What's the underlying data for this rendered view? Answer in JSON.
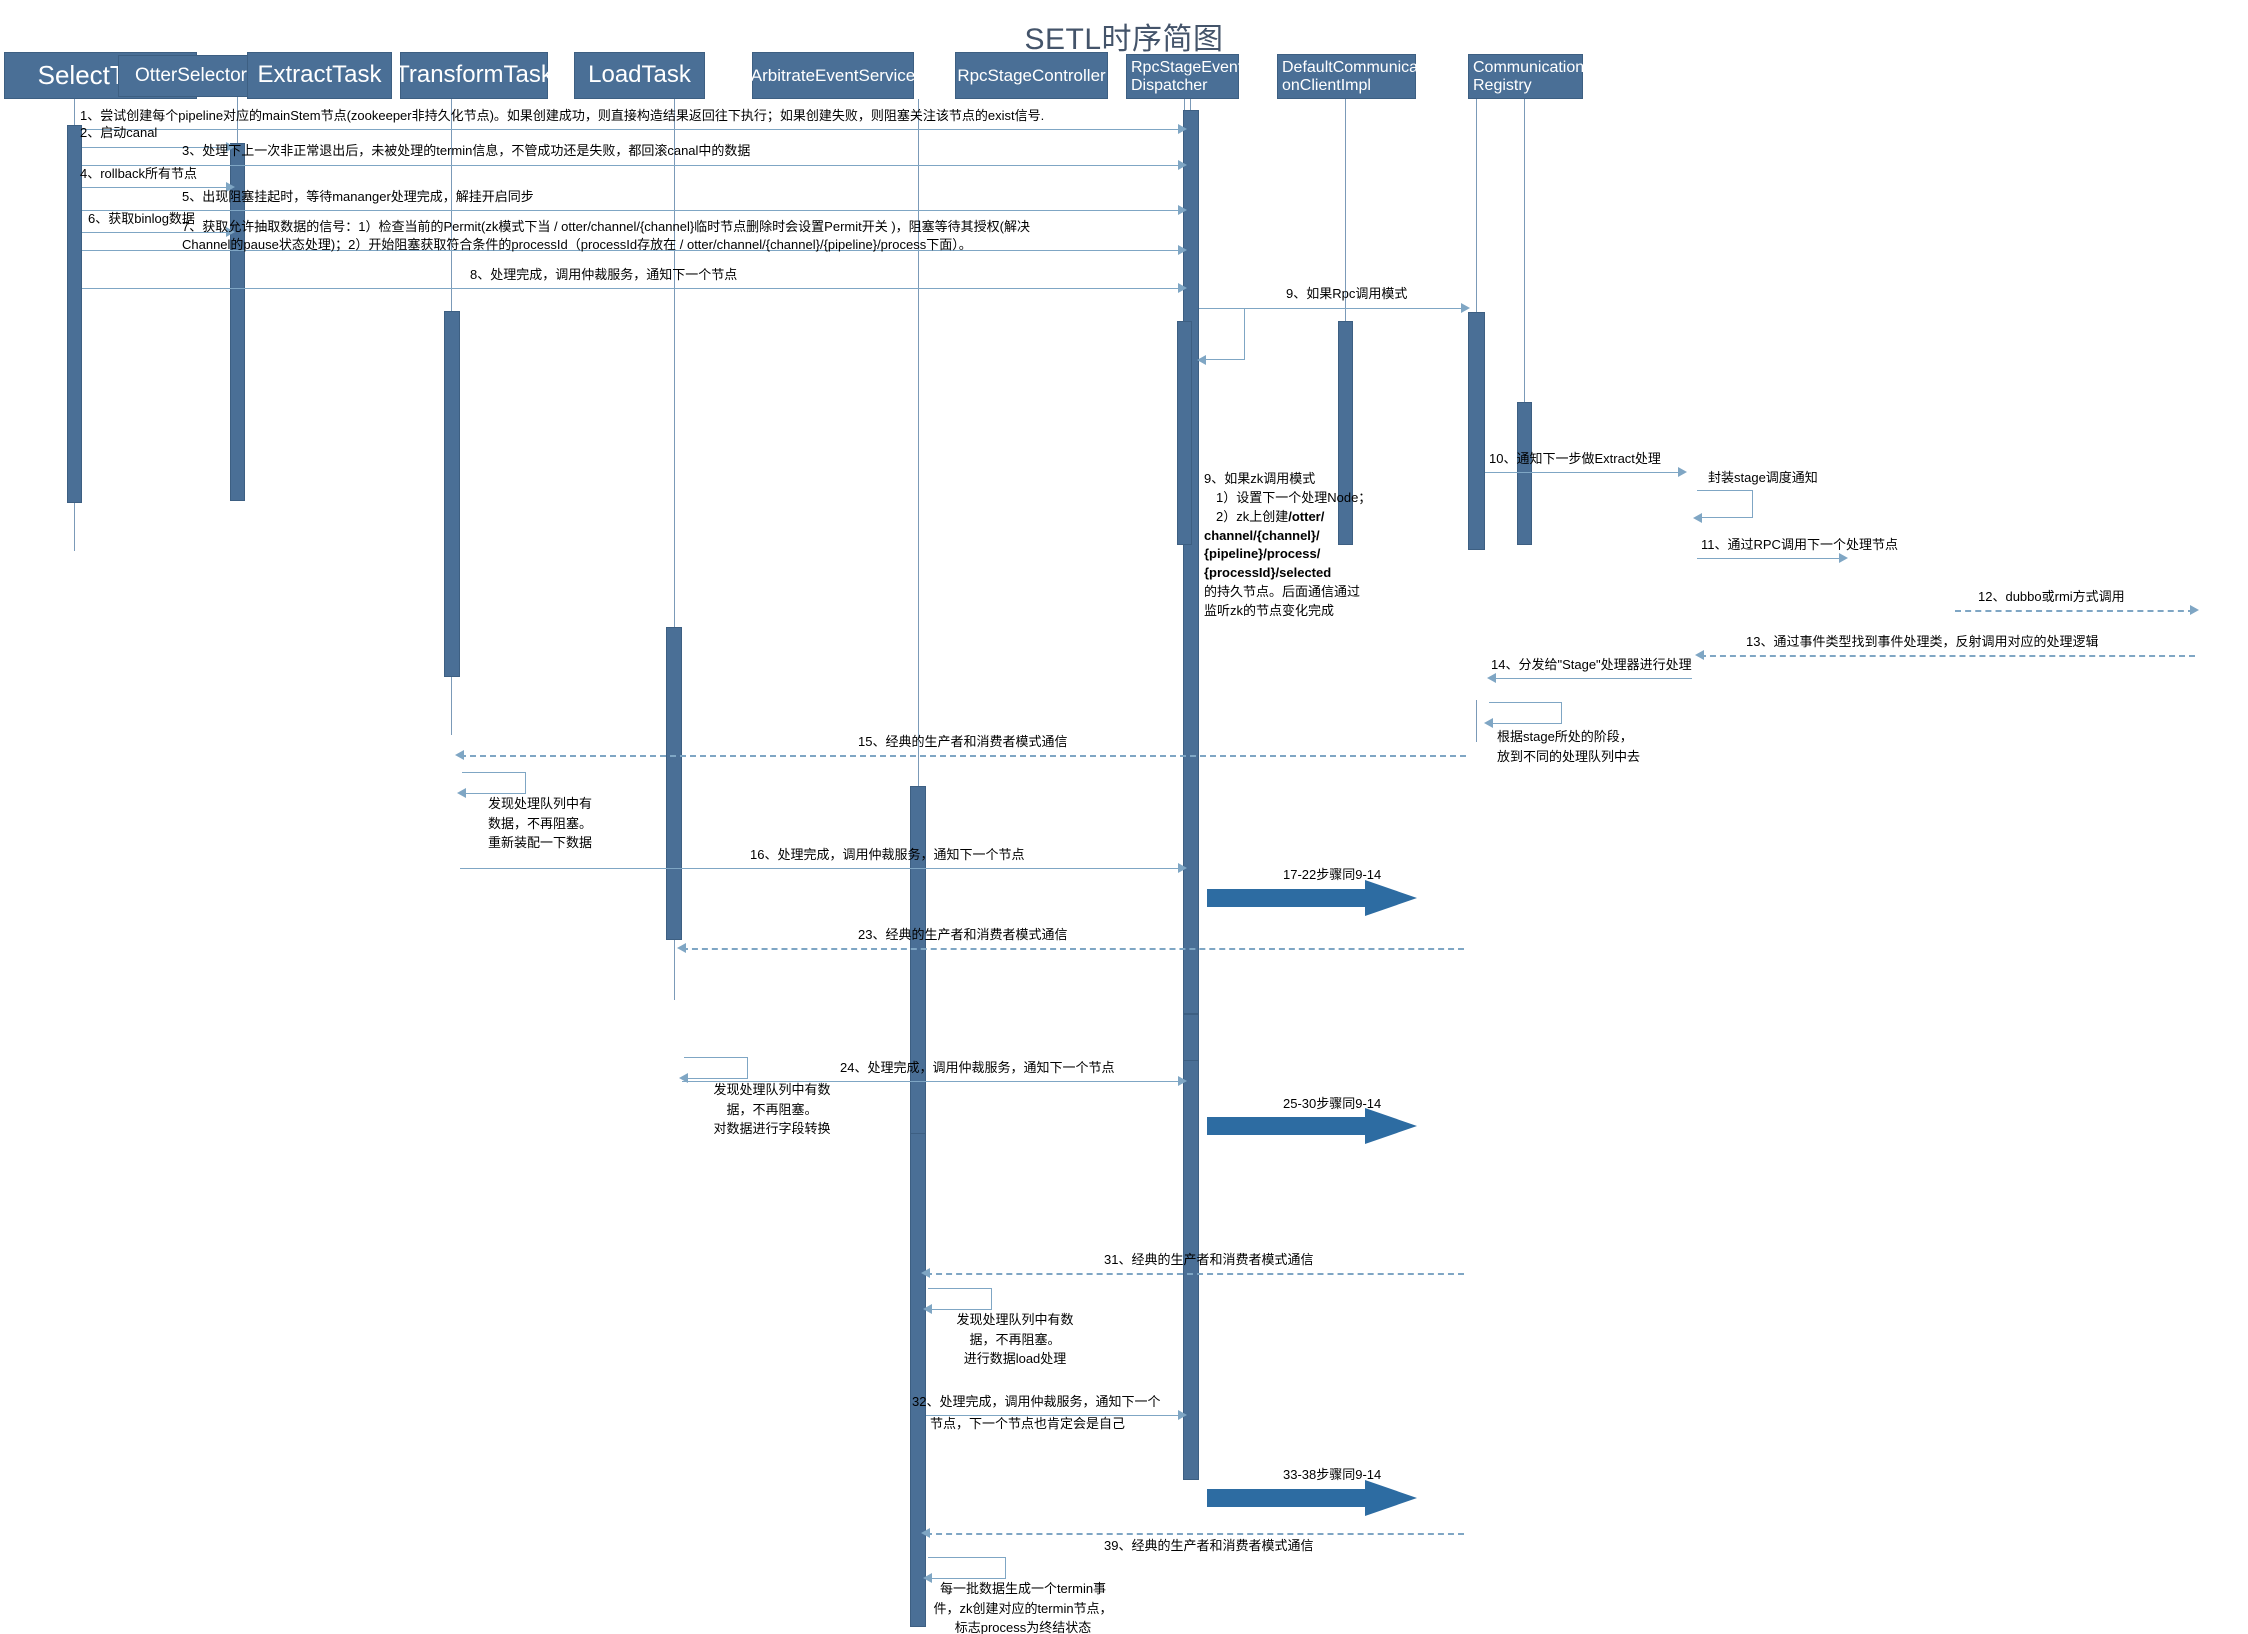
{
  "title": "SETL时序简图",
  "colors": {
    "lifeline_fill": "#4a6f96",
    "message_line": "#7fa6c4",
    "big_arrow": "#2d6ca2",
    "title_text": "#44546a"
  },
  "participants": [
    {
      "name": "SelectTask",
      "label": "SelectTask"
    },
    {
      "name": "OtterSelector",
      "label": "OtterSelector"
    },
    {
      "name": "ExtractTask",
      "label": "ExtractTask"
    },
    {
      "name": "TransformTask",
      "label": "TransformTask"
    },
    {
      "name": "LoadTask",
      "label": "LoadTask"
    },
    {
      "name": "ArbitrateEventService",
      "label": "ArbitrateEventService"
    },
    {
      "name": "RpcStageController",
      "label": "RpcStageController"
    },
    {
      "name": "RpcStageEventDispatcher",
      "label": "RpcStageEvent\nDispatcher"
    },
    {
      "name": "DefaultCommunicationClientImpl",
      "label": "DefaultCommunicati\nonClientImpl"
    },
    {
      "name": "CommunicationRegistry",
      "label": "Communication\nRegistry"
    }
  ],
  "messages": [
    {
      "num": "1",
      "text": "1、尝试创建每个pipeline对应的mainStem节点(zookeeper非持久化节点)。如果创建成功，则直接构造结果返回往下执行；如果创建失败，则阻塞关注该节点的exist信号."
    },
    {
      "num": "2",
      "text": "2、启动canal"
    },
    {
      "num": "3",
      "text": "3、处理下上一次非正常退出后，未被处理的termin信息，不管成功还是失败，都回滚canal中的数据"
    },
    {
      "num": "4",
      "text": "4、rollback所有节点"
    },
    {
      "num": "5",
      "text": "5、出现阻塞挂起时，等待mananger处理完成，解挂开启同步"
    },
    {
      "num": "6",
      "text": "6、获取binlog数据"
    },
    {
      "num": "7a",
      "text": "7、获取允许抽取数据的信号：1）检查当前的Permit(zk模式下当 / otter/channel/{channel}临时节点删除时会设置Permit开关 )，阻塞等待其授权(解决"
    },
    {
      "num": "7b",
      "text": "Channel的pause状态处理)；2）开始阻塞获取符合条件的processId（processId存放在 / otter/channel/{channel}/{pipeline}/process下面）。"
    },
    {
      "num": "8",
      "text": "8、处理完成，调用仲裁服务，通知下一个节点"
    },
    {
      "num": "9",
      "text": "9、如果Rpc调用模式"
    },
    {
      "num": "10",
      "text": "10、通知下一步做Extract处理"
    },
    {
      "num": "s1",
      "text": "封装stage调度通知"
    },
    {
      "num": "11",
      "text": "11、通过RPC调用下一个处理节点"
    },
    {
      "num": "12",
      "text": "12、dubbo或rmi方式调用"
    },
    {
      "num": "13",
      "text": "13、通过事件类型找到事件处理类，反射调用对应的处理逻辑"
    },
    {
      "num": "14",
      "text": "14、分发给\"Stage\"处理器进行处理"
    },
    {
      "num": "15",
      "text": "15、经典的生产者和消费者模式通信"
    },
    {
      "num": "16",
      "text": "16、处理完成，调用仲裁服务，通知下一个节点"
    },
    {
      "num": "23",
      "text": "23、经典的生产者和消费者模式通信"
    },
    {
      "num": "24",
      "text": "24、处理完成，调用仲裁服务，通知下一个节点"
    },
    {
      "num": "31",
      "text": "31、经典的生产者和消费者模式通信"
    },
    {
      "num": "32a",
      "text": "32、处理完成，调用仲裁服务，通知下一个"
    },
    {
      "num": "32b",
      "text": "节点，下一个节点也肯定会是自己"
    },
    {
      "num": "39",
      "text": "39、经典的生产者和消费者模式通信"
    }
  ],
  "zk_note": {
    "line1": "9、如果zk调用模式",
    "line2": "1）设置下一个处理Node；",
    "line3": "2）zk上创建",
    "bold1": "/otter/",
    "bold2": "channel/{channel}/",
    "bold3": "{pipeline}/process/",
    "bold4": "{processId}/selected",
    "line4": "的持久节点。后面通信通过",
    "line5": "监听zk的节点变化完成"
  },
  "notes": [
    {
      "name": "stage-queue-note",
      "lines": [
        "根据stage所处的阶段，",
        "放到不同的处理队列中去"
      ]
    },
    {
      "name": "extract-queue-note",
      "lines": [
        "发现处理队列中有",
        "数据，不再阻塞。",
        "重新装配一下数据"
      ]
    },
    {
      "name": "transform-queue-note",
      "lines": [
        "发现处理队列中有数",
        "据，不再阻塞。",
        "对数据进行字段转换"
      ]
    },
    {
      "name": "load-queue-note",
      "lines": [
        "发现处理队列中有数",
        "据，不再阻塞。",
        "进行数据load处理"
      ]
    },
    {
      "name": "termin-note",
      "lines": [
        "每一批数据生成一个termin事",
        "件，zk创建对应的termin节点，",
        "标志process为终结状态"
      ]
    }
  ],
  "big_arrows": [
    {
      "name": "steps-17-22",
      "label": "17-22步骤同9-14"
    },
    {
      "name": "steps-25-30",
      "label": "25-30步骤同9-14"
    },
    {
      "name": "steps-33-38",
      "label": "33-38步骤同9-14"
    }
  ]
}
